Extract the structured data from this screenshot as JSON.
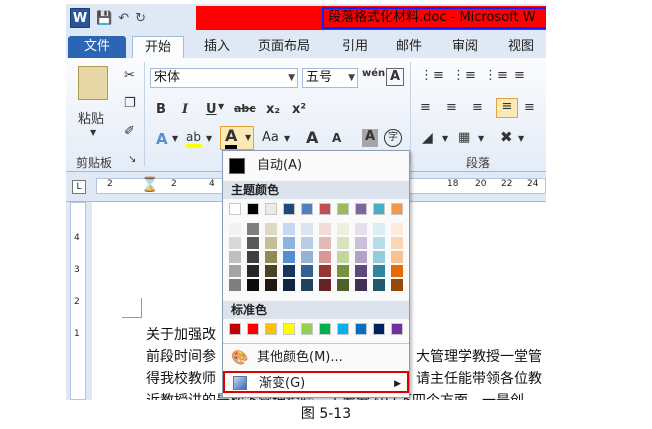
{
  "window": {
    "title": "段落格式化材料.doc - Microsoft W"
  },
  "qat": {
    "logo": "W",
    "icons": [
      "save-icon",
      "undo-icon",
      "redo-icon"
    ]
  },
  "tabs": [
    "文件",
    "开始",
    "插入",
    "页面布局",
    "引用",
    "邮件",
    "审阅",
    "视图"
  ],
  "ribbon": {
    "paste_label": "粘贴",
    "clipboard_label": "剪贴板",
    "paragraph_label": "段落",
    "font_name": "宋体",
    "font_size": "五号",
    "wen": "wén",
    "bold": "B",
    "italic": "I",
    "underline": "U",
    "strike": "abc",
    "subscript": "x₂",
    "superscript": "x²",
    "font_color_letter": "A",
    "change_case": "Aa",
    "grow": "A",
    "shrink": "A",
    "char_shade": "A",
    "enclose": "字",
    "launcher": "↘"
  },
  "ruler": {
    "ticks": [
      "2",
      "2",
      "4",
      "6",
      "8",
      "18",
      "20",
      "22",
      "24",
      "26"
    ],
    "vticks": [
      "1",
      "2",
      "3",
      "4"
    ]
  },
  "document": {
    "lines": [
      {
        "left": "关于加强改",
        "right": ""
      },
      {
        "left": "前段时间参",
        "right": "大管理学教授一堂管"
      },
      {
        "left": "得我校教师",
        "right": "请主任能带领各位教"
      },
      {
        "left": "近教授讲的是松下管理经验，主要分为以下四个方面，一是创",
        "right": ""
      }
    ]
  },
  "popup": {
    "auto_label": "自动(A)",
    "theme_heading": "主题颜色",
    "standard_heading": "标准色",
    "more_colors_label": "其他颜色(M)...",
    "gradient_label": "渐变(G)",
    "theme_top": [
      "#ffffff",
      "#000000",
      "#eeece1",
      "#1f497d",
      "#4f81bd",
      "#c0504d",
      "#9bbb59",
      "#8064a2",
      "#4bacc6",
      "#f79646"
    ],
    "theme_shades": [
      [
        "#f2f2f2",
        "#d8d8d8",
        "#bfbfbf",
        "#a5a5a5",
        "#7f7f7f"
      ],
      [
        "#7f7f7f",
        "#595959",
        "#3f3f3f",
        "#262626",
        "#0c0c0c"
      ],
      [
        "#ddd9c3",
        "#c4bd97",
        "#938953",
        "#494429",
        "#1d1b10"
      ],
      [
        "#c6d9f0",
        "#8db3e2",
        "#548dd4",
        "#17365d",
        "#0f243e"
      ],
      [
        "#dbe5f1",
        "#b8cce4",
        "#95b3d7",
        "#366092",
        "#244061"
      ],
      [
        "#f2dcdb",
        "#e5b9b7",
        "#d99694",
        "#953734",
        "#632423"
      ],
      [
        "#ebf1dd",
        "#d7e3bc",
        "#c3d69b",
        "#76923c",
        "#4f6128"
      ],
      [
        "#e5e0ec",
        "#ccc1d9",
        "#b2a2c7",
        "#5f497a",
        "#3f3151"
      ],
      [
        "#dbeef3",
        "#b7dde8",
        "#92cddc",
        "#31859b",
        "#205867"
      ],
      [
        "#fdeada",
        "#fbd5b5",
        "#fac08f",
        "#e36c09",
        "#974806"
      ]
    ],
    "standard": [
      "#c00000",
      "#ff0000",
      "#ffc000",
      "#ffff00",
      "#92d050",
      "#00b050",
      "#00b0f0",
      "#0070c0",
      "#002060",
      "#7030a0"
    ]
  },
  "caption": "图 5-13"
}
